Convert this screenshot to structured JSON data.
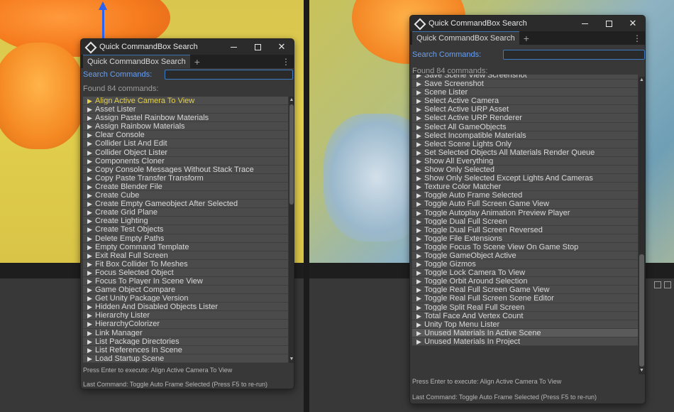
{
  "app": {
    "window_title": "Quick CommandBox Search",
    "tab_label": "Quick CommandBox Search",
    "tab_add": "+",
    "tab_menu": "⋮",
    "search_label": "Search Commands:",
    "search_value": "",
    "found_label": "Found 84 commands:",
    "press_enter": "Press Enter to execute: Align Active Camera To View",
    "last_command": "Last Command: Toggle Auto Frame Selected (Press F5 to re-run)"
  },
  "left_items": [
    "Align Active Camera To View",
    "Asset Lister",
    "Assign Pastel Rainbow Materials",
    "Assign Rainbow Materials",
    "Clear Console",
    "Collider List And Edit",
    "Collider Object Lister",
    "Components Cloner",
    "Copy  Console Messages Without Stack Trace",
    "Copy Paste Transfer Transform",
    "Create Blender File",
    "Create Cube",
    "Create Empty Gameobject After Selected",
    "Create Grid Plane",
    "Create Lighting",
    "Create Test Objects",
    "Delete Empty Paths",
    "Empty Command Template",
    "Exit Real Full Screen",
    "Fit Box Collider To Meshes",
    "Focus Selected Object",
    "Focus To Player In Scene View",
    "Game Object Compare",
    "Get Unity Package Version",
    "Hidden And Disabled Objects Lister",
    "Hierarchy Lister",
    "HierarchyColorizer",
    "Link Manager",
    "List Package Directories",
    "List References In Scene",
    "Load Startup Scene"
  ],
  "right_items": [
    "Save Scene View Screenshot",
    "Save Screenshot",
    "Scene Lister",
    "Select Active Camera",
    "Select Active URP Asset",
    "Select Active URP Renderer",
    "Select All GameObjects",
    "Select Incompatible Materials",
    "Select Scene Lights Only",
    "Set Selected Objects All Materials Render Queue",
    "Show All Everything",
    "Show Only Selected",
    "Show Only Selected Except Lights And Cameras",
    "Texture Color Matcher",
    "Toggle Auto Frame Selected",
    "Toggle Auto Full Screen Game View",
    "Toggle Autoplay Animation Preview Player",
    "Toggle Dual Full Screen",
    "Toggle Dual Full Screen Reversed",
    "Toggle File Extensions",
    "Toggle Focus To Scene View On Game Stop",
    "Toggle GameObject Active",
    "Toggle Gizmos",
    "Toggle Lock Camera To View",
    "Toggle Orbit Around Selection",
    "Toggle Real Full Screen Game View",
    "Toggle Real Full Screen Scene Editor",
    "Toggle Split Real Full Screen",
    "Total Face And Vertex Count",
    "Unity Top Menu Lister",
    "Unused Materials In Active Scene",
    "Unused Materials In Project"
  ],
  "left_selected_index": 0,
  "right_hovered_index": 30,
  "left_scroll_fraction": 0.0,
  "right_scroll_fraction": 1.0,
  "colors": {
    "selected_text": "#e3d14a",
    "search_label": "#6a9ff0",
    "input_border": "#3b79c0"
  },
  "icons": {
    "arrow": "▶",
    "scroll_up": "▲",
    "scroll_down": "▼",
    "close": "✕"
  }
}
